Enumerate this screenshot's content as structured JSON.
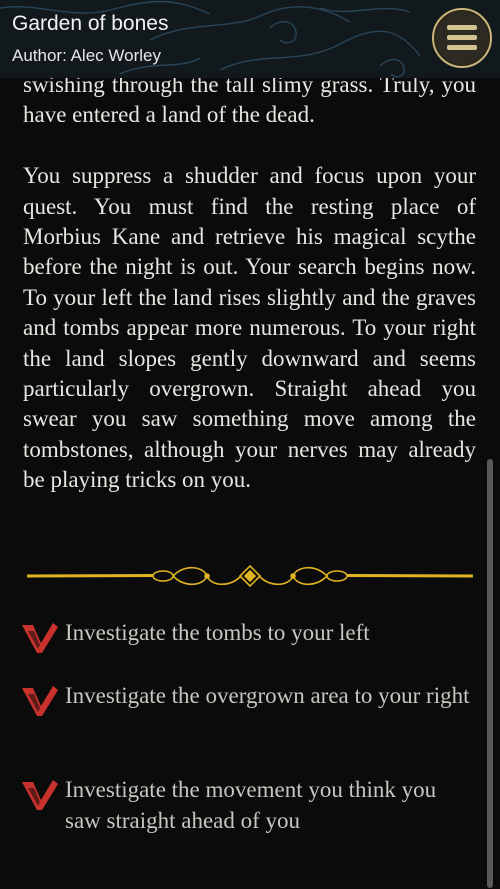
{
  "header": {
    "title": "Garden of bones",
    "author": "Author: Alec Worley",
    "menu_icon": "hamburger-menu-icon"
  },
  "story": {
    "paragraphs": [
      "swishing through the tall slimy grass. Truly, you have entered a land of the dead.",
      "You suppress a shudder and focus upon your quest. You must find the resting place of Morbius Kane and retrieve his magical scythe before the night is out. Your search begins now. To your left the land rises slightly and the graves and tombs appear more numerous. To your right the land slopes gently downward and seems particularly overgrown. Straight ahead you swear you saw something move among the tombstones, although your nerves may already be playing tricks on you."
    ]
  },
  "choices": [
    {
      "label": "Investigate the tombs to your left"
    },
    {
      "label": "Investigate the overgrown area to your right"
    },
    {
      "label": "Investigate the movement you think you saw straight ahead of you"
    }
  ],
  "theme": {
    "header_bg": "#12191d",
    "body_bg": "#0b0b0b",
    "gold": "#e0b322",
    "choice_mark": "#c9322c"
  }
}
